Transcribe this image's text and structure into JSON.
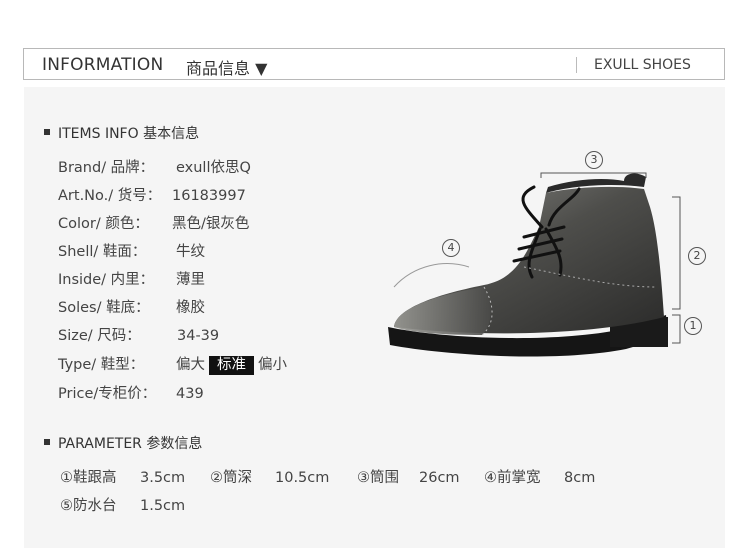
{
  "header": {
    "title": "INFORMATION",
    "subtitle": "商品信息 ▼",
    "brand": "EXULL SHOES"
  },
  "items_section": {
    "label": "ITEMS INFO 基本信息"
  },
  "items": [
    {
      "label": "Brand/  品牌：",
      "value": "exull依思Q"
    },
    {
      "label": "Art.No./ 货号：",
      "value": "16183997"
    },
    {
      "label": "Color/  颜色：",
      "value": "黑色/银灰色"
    },
    {
      "label": "Shell/   鞋面：",
      "value": "牛纹"
    },
    {
      "label": "Inside/  内里：",
      "value": "薄里"
    },
    {
      "label": "Soles/   鞋底：",
      "value": "橡胶"
    },
    {
      "label": "Size/    尺码：",
      "value": "34-39"
    },
    {
      "label": "Price/专柜价：",
      "value": "439"
    }
  ],
  "type_row": {
    "label": "Type/   鞋型：",
    "options": [
      "偏大",
      "标准",
      "偏小"
    ],
    "selected": "标准"
  },
  "param_section": {
    "label": "PARAMETER 参数信息"
  },
  "params": [
    {
      "label": "①鞋跟高",
      "value": "3.5cm"
    },
    {
      "label": "②筒深",
      "value": "10.5cm"
    },
    {
      "label": "③筒围",
      "value": "26cm"
    },
    {
      "label": "④前掌宽",
      "value": "8cm"
    },
    {
      "label": "⑤防水台",
      "value": "1.5cm"
    }
  ],
  "dimension_markers": [
    "1",
    "2",
    "3",
    "4"
  ],
  "colors": {
    "tag_bg": "#111111",
    "panel_bg": "#f5f5f5",
    "border": "#b8b8b8"
  }
}
